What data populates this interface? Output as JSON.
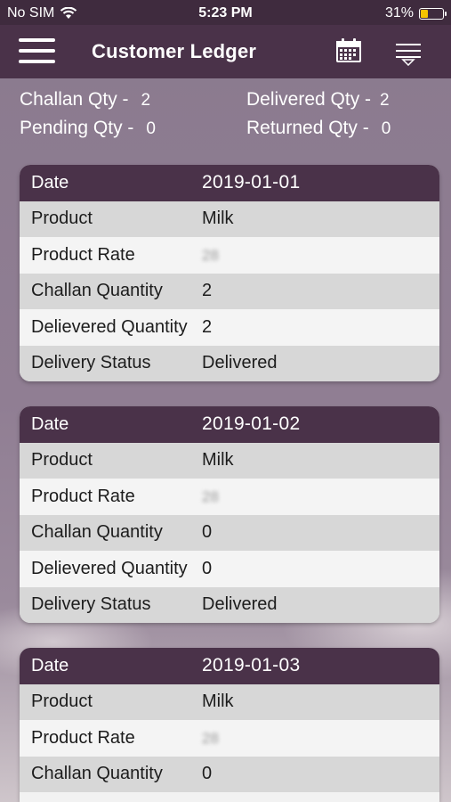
{
  "status_bar": {
    "carrier": "No SIM",
    "time": "5:23 PM",
    "battery": "31%",
    "battery_level": 0.31
  },
  "header": {
    "title": "Customer Ledger",
    "menu_icon": "hamburger-menu-icon",
    "calendar_icon": "calendar-icon",
    "filter_icon": "filter-icon"
  },
  "summary": {
    "challan_label": "Challan Qty -",
    "challan_value": "2",
    "delivered_label": "Delivered Qty -",
    "delivered_value": "2",
    "pending_label": "Pending Qty -",
    "pending_value": "0",
    "returned_label": "Returned Qty -",
    "returned_value": "0"
  },
  "labels": {
    "date": "Date",
    "product": "Product",
    "product_rate": "Product Rate",
    "challan_quantity": "Challan Quantity",
    "delivered_quantity": "Delievered Quantity",
    "delivery_status": "Delivery Status"
  },
  "entries": [
    {
      "date": "2019-01-01",
      "product": "Milk",
      "rate": "28",
      "challan_qty": "2",
      "delivered_qty": "2",
      "status": "Delivered"
    },
    {
      "date": "2019-01-02",
      "product": "Milk",
      "rate": "28",
      "challan_qty": "0",
      "delivered_qty": "0",
      "status": "Delivered"
    },
    {
      "date": "2019-01-03",
      "product": "Milk",
      "rate": "28",
      "challan_qty": "0"
    }
  ],
  "colors": {
    "primary": "#4a3249",
    "status_bar": "#3f2b3e",
    "background": "#8d7b90",
    "row_alt": "#d7d7d7",
    "row": "#f4f4f4"
  }
}
